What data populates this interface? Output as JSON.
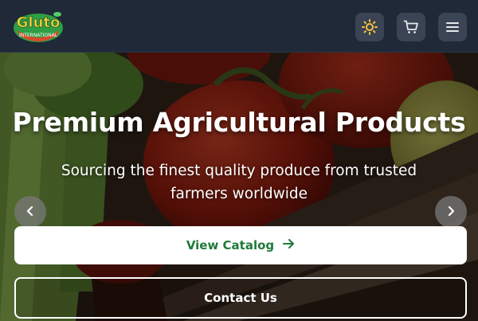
{
  "header": {
    "logo_text": "Gluto",
    "logo_subtext": "INTERNATIONAL",
    "icons": [
      "sun-icon",
      "cart-icon",
      "menu-icon"
    ]
  },
  "hero": {
    "title": "Premium Agricultural Products",
    "subtitle": "Sourcing the finest quality produce from trusted farmers worldwide",
    "primary_button": "View Catalog",
    "secondary_button": "Contact Us"
  },
  "colors": {
    "header_bg": "#1f2937",
    "primary_text": "#1f7a3a",
    "icon_sun": "#f5c23a"
  }
}
